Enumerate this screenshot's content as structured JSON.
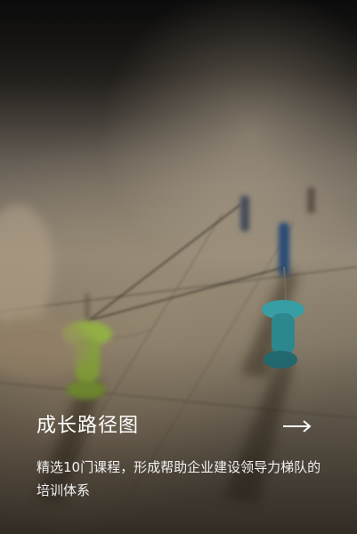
{
  "card": {
    "title": "成长路径图",
    "description": "精选10门课程，形成帮助企业建设领导力梯队的培训体系",
    "arrow_icon": "arrow-right-icon",
    "background_image": "pushpins-on-map-photo"
  },
  "colors": {
    "text": "#ffffff",
    "pin_green": "#9ab84a",
    "pin_teal": "#2f8f96",
    "pin_blue": "#2b4f7a"
  }
}
